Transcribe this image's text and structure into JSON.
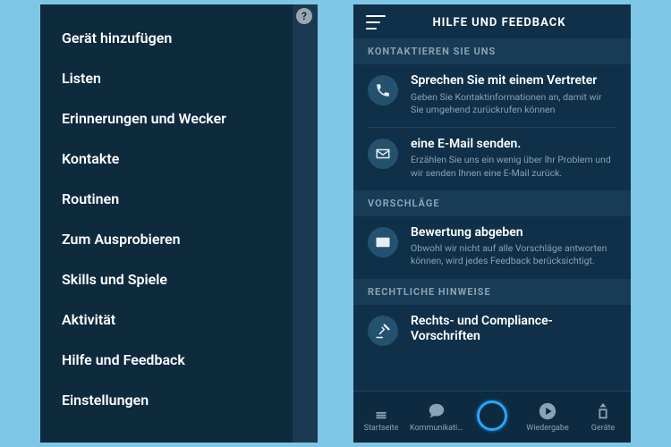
{
  "left": {
    "menu": [
      "Gerät hinzufügen",
      "Listen",
      "Erinnerungen und Wecker",
      "Kontakte",
      "Routinen",
      "Zum Ausprobieren",
      "Skills und Spiele",
      "Aktivität",
      "Hilfe und Feedback",
      "Einstellungen"
    ],
    "help_glyph": "?"
  },
  "right": {
    "title": "HILFE UND FEEDBACK",
    "sections": {
      "contact_label": "KONTAKTIEREN SIE UNS",
      "suggestions_label": "VORSCHLÄGE",
      "legal_label": "RECHTLICHE HINWEISE"
    },
    "rows": {
      "rep": {
        "title": "Sprechen Sie mit einem Vertreter",
        "desc": "Geben Sie Kontaktinformationen an, damit wir Sie umgehend zurückrufen können"
      },
      "email": {
        "title": "eine E-Mail senden.",
        "desc": "Erzählen Sie uns ein wenig über Ihr Problem und wir senden Ihnen eine E-Mail zurück."
      },
      "rate": {
        "title": "Bewertung abgeben",
        "desc": "Obwohl wir nicht auf alle Vorschläge antworten können, wird jedes Feedback berücksichtigt."
      },
      "legal": {
        "title": "Rechts- und Compliance-Vorschriften"
      }
    },
    "tabs": {
      "home": "Startseite",
      "comm": "Kommunikati...",
      "play": "Wiedergabe",
      "devices": "Geräte"
    }
  }
}
